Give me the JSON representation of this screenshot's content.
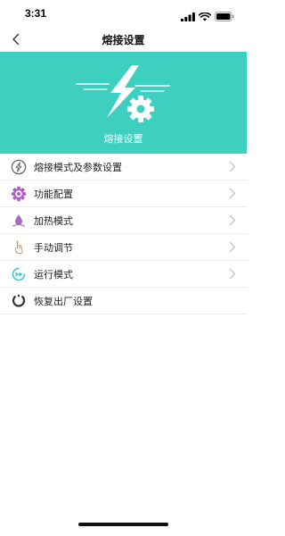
{
  "status_bar": {
    "time": "3:31"
  },
  "nav": {
    "title": "熔接设置",
    "back_icon": "chevron-left-icon"
  },
  "banner": {
    "caption": "熔接设置",
    "background_color": "#3dcfc0",
    "graphic_icon": "lightning-gear-icon"
  },
  "menu": {
    "items": [
      {
        "label": "熔接模式及参数设置",
        "icon": "lightning-circle-icon",
        "has_chevron": true
      },
      {
        "label": "功能配置",
        "icon": "gear-icon",
        "has_chevron": true
      },
      {
        "label": "加热模式",
        "icon": "flame-drop-icon",
        "has_chevron": true
      },
      {
        "label": "手动调节",
        "icon": "hand-pointer-icon",
        "has_chevron": true
      },
      {
        "label": "运行模式",
        "icon": "run-mode-icon",
        "has_chevron": true
      },
      {
        "label": "恢复出厂设置",
        "icon": "restore-icon",
        "has_chevron": false
      }
    ]
  }
}
